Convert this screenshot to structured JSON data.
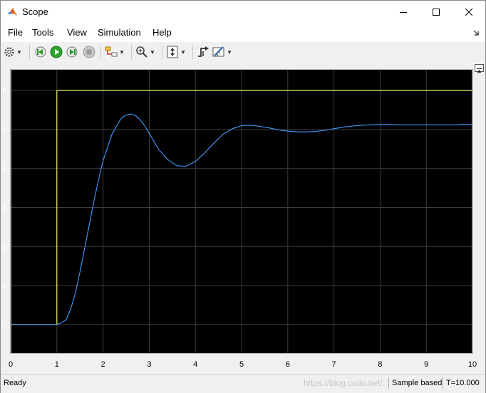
{
  "window": {
    "title": "Scope",
    "icon": "matlab-icon",
    "controls": [
      "minimize-icon",
      "maximize-icon",
      "close-icon"
    ]
  },
  "menu": {
    "file": "File",
    "tools": "Tools",
    "view": "View",
    "simulation": "Simulation",
    "help": "Help"
  },
  "toolbar": {
    "icons": [
      "gear-icon",
      "step-back-icon",
      "run-icon",
      "step-forward-icon",
      "stop-icon",
      "highlight-icon",
      "zoom-icon",
      "autoscale-icon",
      "trigger-icon",
      "cursor-measure-icon"
    ]
  },
  "status": {
    "ready": "Ready",
    "mode": "Sample based",
    "time": "T=10.000"
  },
  "watermark": "https://blog.csdn.net/...",
  "colors": {
    "plot_background": "#000000",
    "grid": "#3c3c3c",
    "axis_text": "#ffffff",
    "step_line": "#ffff66",
    "response_line": "#3f9cff"
  },
  "chart_data": {
    "type": "line",
    "xlim": [
      0,
      10
    ],
    "ylim": [
      -0.75,
      6.55
    ],
    "xticks": [
      "0",
      "1",
      "2",
      "3",
      "4",
      "5",
      "6",
      "7",
      "8",
      "9",
      "10"
    ],
    "yticks": [
      "0",
      "1",
      "2",
      "3",
      "4",
      "5",
      "6"
    ],
    "grid": true,
    "legend": "none",
    "series": [
      {
        "x": [
          0,
          1,
          1,
          10
        ],
        "y": [
          0,
          0,
          6,
          6
        ],
        "color": "#ffff66"
      },
      {
        "x": [
          0,
          1.0,
          1.1,
          1.2,
          1.3,
          1.4,
          1.5,
          1.6,
          1.7,
          1.8,
          1.9,
          2.0,
          2.1,
          2.2,
          2.3,
          2.4,
          2.5,
          2.6,
          2.7,
          2.8,
          2.9,
          3.0,
          3.2,
          3.4,
          3.6,
          3.8,
          4.0,
          4.2,
          4.4,
          4.6,
          4.8,
          5.0,
          5.2,
          5.4,
          5.6,
          5.8,
          6.0,
          6.2,
          6.4,
          6.6,
          6.8,
          7.0,
          7.2,
          7.4,
          7.6,
          7.8,
          8.0,
          8.2,
          8.4,
          8.6,
          8.8,
          9.0,
          9.2,
          9.4,
          9.6,
          9.8,
          10.0
        ],
        "y": [
          0,
          0,
          0.05,
          0.12,
          0.4,
          0.8,
          1.35,
          1.95,
          2.55,
          3.15,
          3.7,
          4.2,
          4.55,
          4.9,
          5.1,
          5.3,
          5.37,
          5.4,
          5.36,
          5.25,
          5.1,
          4.9,
          4.5,
          4.23,
          4.07,
          4.06,
          4.18,
          4.4,
          4.65,
          4.88,
          5.02,
          5.1,
          5.11,
          5.08,
          5.04,
          4.99,
          4.96,
          4.94,
          4.94,
          4.95,
          4.98,
          5.02,
          5.06,
          5.09,
          5.11,
          5.12,
          5.13,
          5.13,
          5.12,
          5.12,
          5.12,
          5.12,
          5.12,
          5.12,
          5.12,
          5.13,
          5.13
        ],
        "color": "#3f9cff"
      }
    ]
  }
}
